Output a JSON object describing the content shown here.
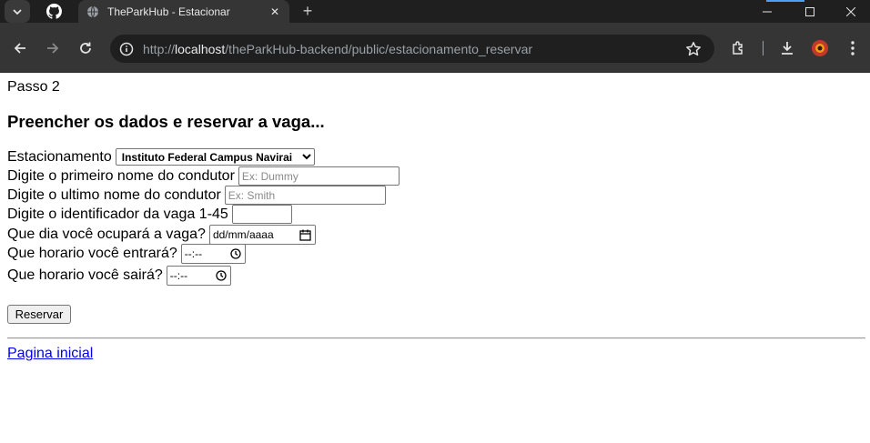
{
  "browser": {
    "tab_title": "TheParkHub - Estacionar",
    "url_prefix": "http://",
    "url_host": "localhost",
    "url_path": "/theParkHub-backend/public/estacionamento_reservar",
    "colors": {
      "tabbar": "#1f1f1f",
      "toolbar": "#353535",
      "accent": "#4d9ef5"
    }
  },
  "page": {
    "step": "Passo 2",
    "heading": "Preencher os dados e reservar a vaga...",
    "fields": {
      "estacionamento_label": "Estacionamento",
      "estacionamento_selected": "Instituto Federal Campus Navirai",
      "first_name_label": "Digite o primeiro nome do condutor",
      "first_name_placeholder": "Ex: Dummy",
      "last_name_label": "Digite o ultimo nome do condutor",
      "last_name_placeholder": "Ex: Smith",
      "vaga_label": "Digite o identificador da vaga 1-45",
      "date_label": "Que dia você ocupará a vaga?",
      "date_placeholder": "dd/mm/aaaa",
      "entry_label": "Que horario você entrará?",
      "exit_label": "Que horario você sairá?",
      "time_placeholder": "--:--"
    },
    "reserve_button": "Reservar",
    "home_link": "Pagina inicial",
    "link_color": "#0000ee"
  }
}
